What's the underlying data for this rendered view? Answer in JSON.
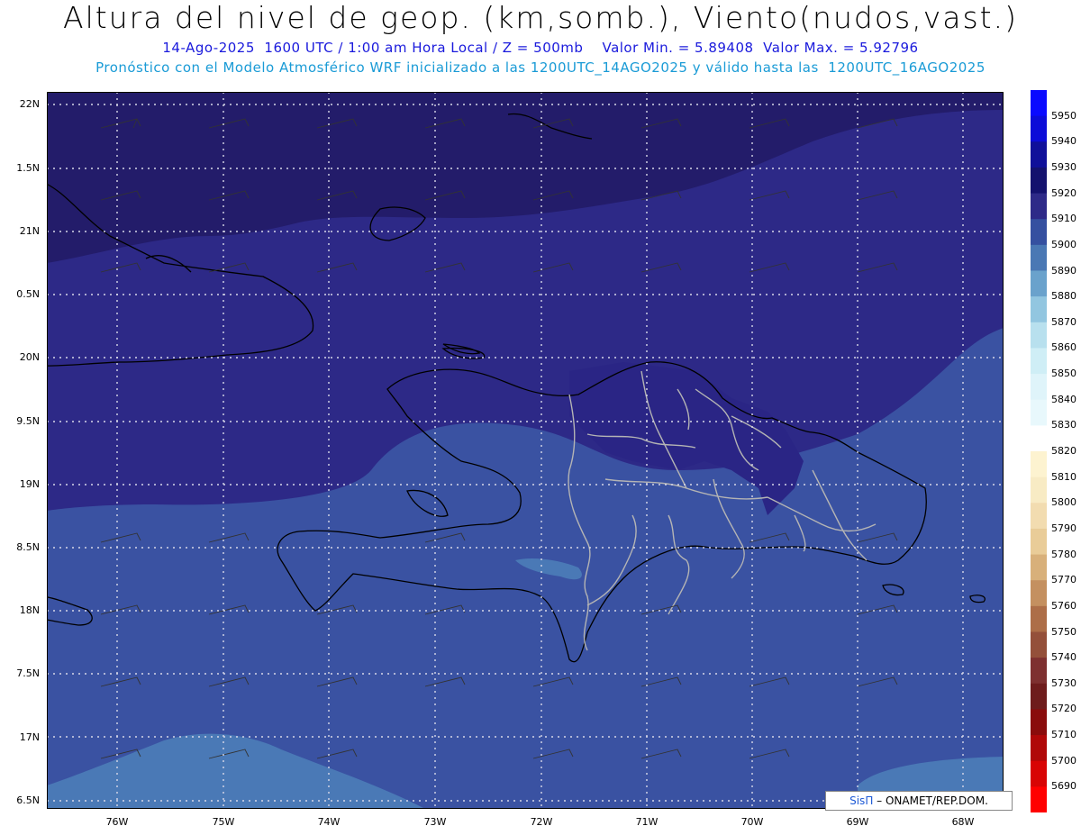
{
  "header": {
    "title": "Altura del nivel de geop. (km,somb.), Viento(nudos,vast.)",
    "subtitle_line1": "14-Ago-2025  1600 UTC / 1:00 am Hora Local / Z = 500mb    Valor Min. = 5.89408  Valor Max. = 5.92796",
    "subtitle_line2": "Pronóstico con el Modelo Atmosférico WRF inicializado a las 1200UTC_14AGO2025 y válido hasta las  1200UTC_16AGO2025"
  },
  "axes": {
    "lat_labels": [
      "22N",
      "1.5N",
      "21N",
      "0.5N",
      "20N",
      "9.5N",
      "19N",
      "8.5N",
      "18N",
      "7.5N",
      "17N",
      "6.5N"
    ],
    "lon_labels": [
      "76W",
      "75W",
      "74W",
      "73W",
      "72W",
      "71W",
      "70W",
      "69W",
      "68W"
    ]
  },
  "colorbar": {
    "labels": [
      "5950",
      "5940",
      "5930",
      "5920",
      "5910",
      "5900",
      "5890",
      "5880",
      "5870",
      "5860",
      "5850",
      "5840",
      "5830",
      "5820",
      "5810",
      "5800",
      "5790",
      "5780",
      "5770",
      "5760",
      "5750",
      "5740",
      "5730",
      "5720",
      "5710",
      "5700",
      "5690"
    ],
    "colors": [
      "#0a0aff",
      "#0c0cd8",
      "#10109a",
      "#14126e",
      "#2e2a88",
      "#3550a0",
      "#4a78b4",
      "#6aa2cc",
      "#92c6e0",
      "#b8e0ee",
      "#cfeef6",
      "#dff4fa",
      "#e8f8fc",
      "#ffffff",
      "#fdf3d0",
      "#f8ebc4",
      "#f2dcb0",
      "#e9cc98",
      "#d8b07a",
      "#c49060",
      "#ad6e48",
      "#94503a",
      "#7e3030",
      "#6e1c1c",
      "#8a0c0c",
      "#b00808",
      "#d80404",
      "#ff0000"
    ]
  },
  "colors": {
    "deep": "#231c6a",
    "mid": "#2d2987",
    "base": "#3a52a2",
    "light": "#4a79b6",
    "coast": "#000000",
    "border": "#b4b4b4"
  },
  "credit": {
    "brand": "SisΠ",
    "text": "– ONAMET/REP.DOM."
  }
}
